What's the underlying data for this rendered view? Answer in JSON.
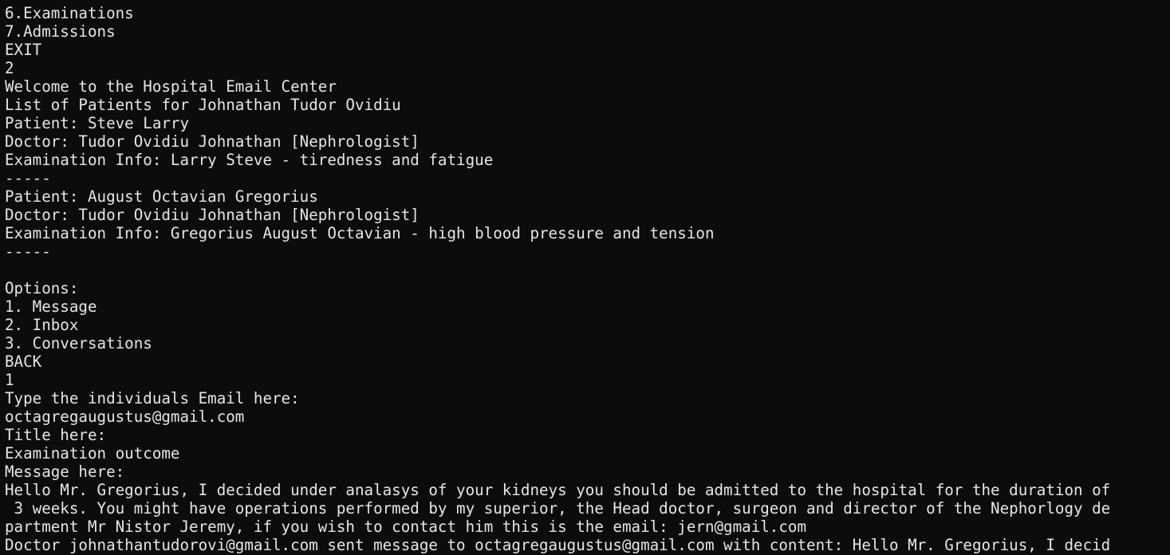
{
  "terminal": {
    "background_color": "#0c0c0c",
    "text_color": "#e6e6e6",
    "lines": [
      "6.Examinations",
      "7.Admissions",
      "EXIT",
      "2",
      "Welcome to the Hospital Email Center",
      "List of Patients for Johnathan Tudor Ovidiu",
      "Patient: Steve Larry",
      "Doctor: Tudor Ovidiu Johnathan [Nephrologist]",
      "Examination Info: Larry Steve - tiredness and fatigue",
      "-----",
      "Patient: August Octavian Gregorius",
      "Doctor: Tudor Ovidiu Johnathan [Nephrologist]",
      "Examination Info: Gregorius August Octavian - high blood pressure and tension",
      "-----",
      "",
      "Options:",
      "1. Message",
      "2. Inbox",
      "3. Conversations",
      "BACK",
      "1",
      "Type the individuals Email here:",
      "octagregaugustus@gmail.com",
      "Title here:",
      "Examination outcome",
      "Message here:",
      "Hello Mr. Gregorius, I decided under analasys of your kidneys you should be admitted to the hospital for the duration of",
      " 3 weeks. You might have operations performed by my superior, the Head doctor, surgeon and director of the Nephorlogy de",
      "partment Mr Nistor Jeremy, if you wish to contact him this is the email: jern@gmail.com",
      "Doctor johnathantudorovi@gmail.com sent message to octagregaugustus@gmail.com with content: Hello Mr. Gregorius, I decid"
    ]
  }
}
